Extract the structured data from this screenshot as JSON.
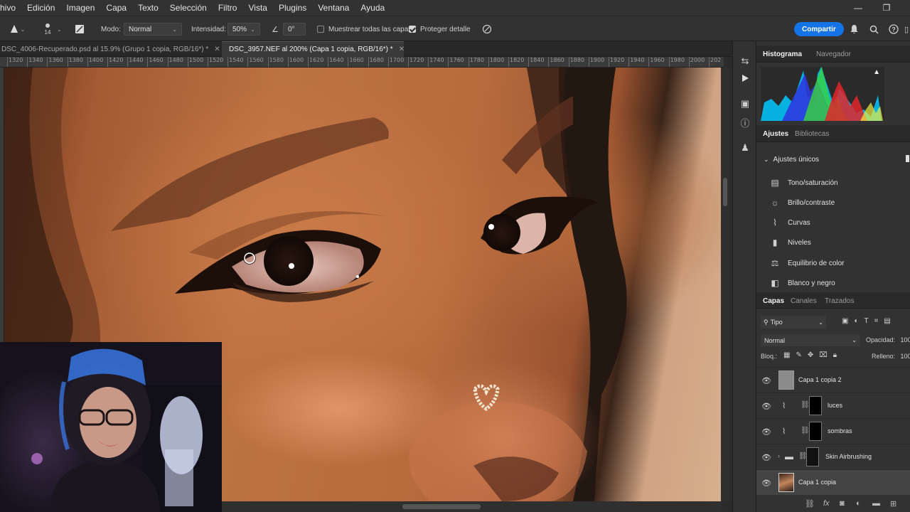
{
  "menu": [
    "chivo",
    "Edición",
    "Imagen",
    "Capa",
    "Texto",
    "Selección",
    "Filtro",
    "Vista",
    "Plugins",
    "Ventana",
    "Ayuda"
  ],
  "window_controls": {
    "minimize": "—",
    "restore": "❐"
  },
  "options_bar": {
    "brush_size": "14",
    "mode_label": "Modo:",
    "mode_value": "Normal",
    "intensity_label": "Intensidad:",
    "intensity_value": "50%",
    "angle_value": "0°",
    "sample_all_label": "Muestrear todas las capas",
    "sample_all_checked": false,
    "protect_detail_label": "Proteger detalle",
    "protect_detail_checked": true,
    "share_label": "Compartir"
  },
  "tabs": [
    {
      "label": "DSC_4006-Recuperado.psd al 15.9% (Grupo 1 copia, RGB/16*) *",
      "active": false
    },
    {
      "label": "DSC_3957.NEF al 200% (Capa 1 copia, RGB/16*) *",
      "active": true
    }
  ],
  "ruler": [
    "1320",
    "1340",
    "1360",
    "1380",
    "1400",
    "1420",
    "1440",
    "1460",
    "1480",
    "1500",
    "1520",
    "1540",
    "1560",
    "1580",
    "1600",
    "1620",
    "1640",
    "1660",
    "1680",
    "1700",
    "1720",
    "1740",
    "1760",
    "1780",
    "1800",
    "1820",
    "1840",
    "1860",
    "1880",
    "1900",
    "1920",
    "1940",
    "1960",
    "1980",
    "2000",
    "202"
  ],
  "panels": {
    "histogram_tabs": [
      "Histograma",
      "Navegador"
    ],
    "histogram_warning": "▲",
    "adjust_tabs": [
      "Ajustes",
      "Bibliotecas"
    ],
    "adjust_section": "Ajustes únicos",
    "adjustments": [
      {
        "label": "Tono/saturación",
        "icon": "hue-saturation-icon"
      },
      {
        "label": "Brillo/contraste",
        "icon": "brightness-icon"
      },
      {
        "label": "Curvas",
        "icon": "curves-icon"
      },
      {
        "label": "Niveles",
        "icon": "levels-icon"
      },
      {
        "label": "Equilibrio de color",
        "icon": "color-balance-icon"
      },
      {
        "label": "Blanco y negro",
        "icon": "black-white-icon"
      }
    ],
    "layer_tabs": [
      "Capas",
      "Canales",
      "Trazados"
    ],
    "filter_kind": "Tipo",
    "blend_mode": "Normal",
    "opacity_label": "Opacidad:",
    "opacity_value": "100",
    "lock_label": "Bloq.:",
    "fill_label": "Relleno:",
    "fill_value": "100",
    "layers": [
      {
        "name": "Capa 1 copia 2",
        "kind": "pixel"
      },
      {
        "name": "luces",
        "kind": "curves-mask"
      },
      {
        "name": "sombras",
        "kind": "curves-mask"
      },
      {
        "name": "Skin Airbrushing",
        "kind": "group"
      },
      {
        "name": "Capa 1 copia",
        "kind": "photo",
        "selected": true
      }
    ],
    "bottom_icons": [
      "link-icon",
      "fx-icon",
      "mask-icon",
      "adjustment-icon",
      "folder-icon",
      "new-layer-icon"
    ]
  },
  "colors": {
    "accent": "#1473e6",
    "panel": "#323232",
    "dark": "#282828"
  }
}
